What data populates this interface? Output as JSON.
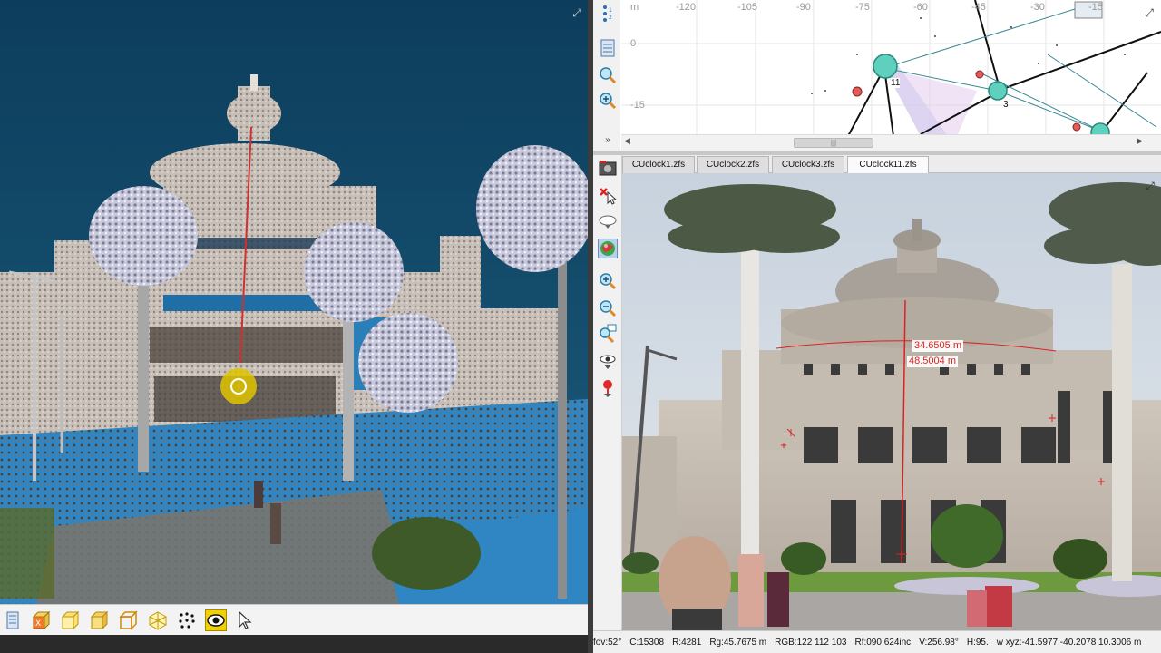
{
  "map": {
    "axis_top": [
      "m",
      "-120",
      "-105",
      "-90",
      "-75",
      "-60",
      "-45",
      "-30",
      "-15"
    ],
    "axis_left": [
      "0",
      "-15"
    ],
    "station_labels": [
      "11",
      "3"
    ]
  },
  "tabs": [
    {
      "label": "CUclock1.zfs",
      "active": false
    },
    {
      "label": "CUclock2.zfs",
      "active": false
    },
    {
      "label": "CUclock3.zfs",
      "active": false
    },
    {
      "label": "CUclock11.zfs",
      "active": true
    }
  ],
  "photo": {
    "measure_1": "34.6505 m",
    "measure_2": "48.5004 m"
  },
  "status": {
    "fov": "fov:52°",
    "c": "C:15308",
    "r": "R:4281",
    "rg": "Rg:45.7675 m",
    "rgb": "RGB:122 112 103",
    "rf": "Rf:090 624inc",
    "v": "V:256.98°",
    "h": "H:95.",
    "xyz": "w xyz:-41.5977 -40.2078 10.3006 m"
  },
  "icons": {
    "left_toolbar": [
      "layers-icon",
      "cube-x-icon",
      "cube-outline-icon",
      "cube-face-icon",
      "cube-wire-icon",
      "cube-iso-icon",
      "points-icon",
      "eye-icon",
      "cursor-icon"
    ],
    "map_side": [
      "hierarchy-icon",
      "list-icon",
      "zoom-home-icon",
      "zoom-plus-icon",
      "chevron-down-icon"
    ],
    "photo_side": [
      "photo-icon",
      "close-cursor-icon",
      "cloud-icon",
      "sphere-icon",
      "zoom-in-icon",
      "zoom-out-icon",
      "zoom-window-icon",
      "view-eye-icon",
      "pin-icon"
    ]
  }
}
